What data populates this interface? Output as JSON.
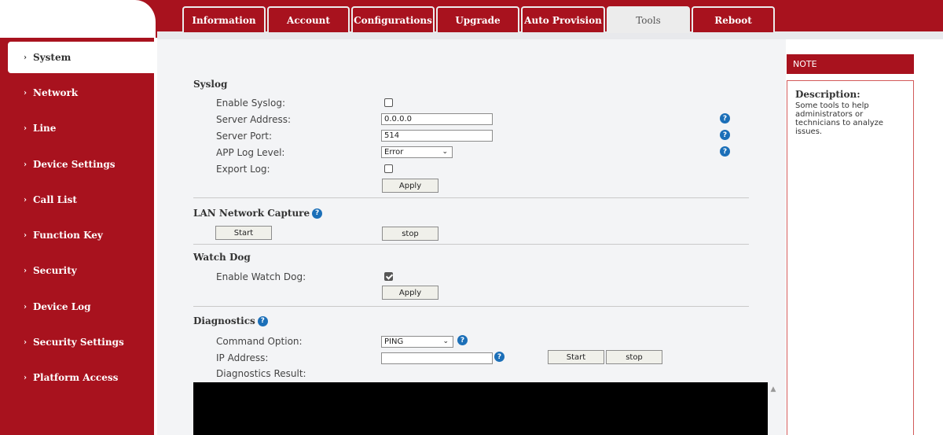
{
  "colors": {
    "brand": "#a8121e",
    "tab_active_bg": "#ececec",
    "content_bg": "#f3f4f6",
    "help_icon": "#1b6fb8"
  },
  "tabs": [
    {
      "label": "Information"
    },
    {
      "label": "Account"
    },
    {
      "label": "Configurations"
    },
    {
      "label": "Upgrade"
    },
    {
      "label": "Auto Provision"
    },
    {
      "label": "Tools",
      "active": true
    },
    {
      "label": "Reboot"
    }
  ],
  "sidebar": {
    "items": [
      {
        "label": "System",
        "active": true
      },
      {
        "label": "Network"
      },
      {
        "label": "Line"
      },
      {
        "label": "Device Settings"
      },
      {
        "label": "Call List"
      },
      {
        "label": "Function Key"
      },
      {
        "label": "Security"
      },
      {
        "label": "Device Log"
      },
      {
        "label": "Security Settings"
      },
      {
        "label": "Platform Access"
      }
    ]
  },
  "syslog": {
    "title": "Syslog",
    "enable_label": "Enable Syslog:",
    "enable_checked": false,
    "server_address_label": "Server Address:",
    "server_address_value": "0.0.0.0",
    "server_port_label": "Server Port:",
    "server_port_value": "514",
    "app_log_level_label": "APP Log Level:",
    "app_log_level_value": "Error",
    "export_log_label": "Export Log:",
    "export_log_checked": false,
    "apply_label": "Apply"
  },
  "lan_capture": {
    "title": "LAN Network Capture",
    "start_label": "Start",
    "stop_label": "stop"
  },
  "watchdog": {
    "title": "Watch Dog",
    "enable_label": "Enable Watch Dog:",
    "enable_checked": true,
    "apply_label": "Apply"
  },
  "diagnostics": {
    "title": "Diagnostics",
    "command_option_label": "Command Option:",
    "command_option_value": "PING",
    "ip_address_label": "IP Address:",
    "ip_address_value": "",
    "start_label": "Start",
    "stop_label": "stop",
    "result_label": "Diagnostics Result:"
  },
  "note": {
    "header": "NOTE",
    "title": "Description:",
    "text": "Some tools to help administrators or technicians to analyze issues."
  },
  "help_glyph": "?",
  "chevron_glyph": "›",
  "dropdown_glyph": "⌄"
}
